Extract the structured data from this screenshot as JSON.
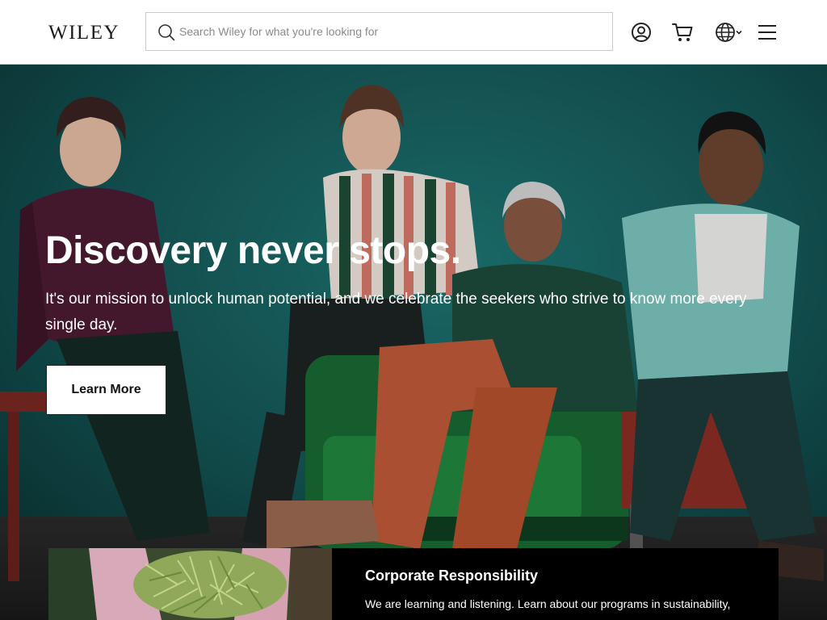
{
  "header": {
    "logo": "WILEY",
    "search_placeholder": "Search Wiley for what you're looking for",
    "icons": [
      "account-icon",
      "cart-icon",
      "globe-icon",
      "chevron-down-icon",
      "menu-icon"
    ]
  },
  "hero": {
    "title": "Discovery never stops.",
    "subtitle": "It's our mission to unlock human potential, and we celebrate the seekers who strive to know more every single day.",
    "button_label": "Learn More"
  },
  "card": {
    "title": "Corporate Responsibility",
    "text": "We are learning and listening. Learn about our programs in sustainability,"
  },
  "colors": {
    "header_bg": "#ffffff",
    "hero_wall": "#16595a",
    "button_bg": "#ffffff",
    "card_bg": "#000000",
    "text_light": "#ffffff"
  }
}
